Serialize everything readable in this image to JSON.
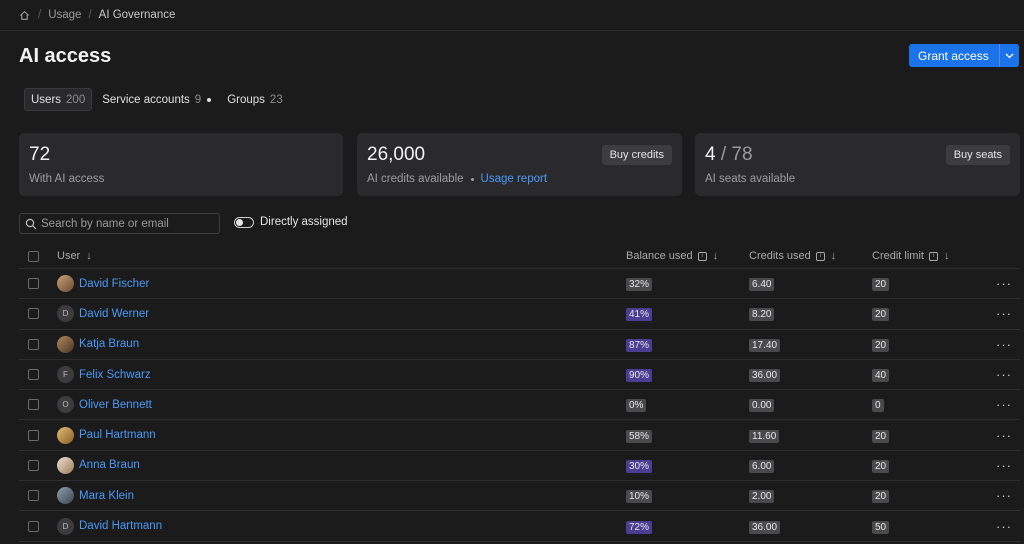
{
  "breadcrumb": {
    "items": [
      "Usage",
      "AI Governance"
    ]
  },
  "page": {
    "title": "AI access",
    "grant_label": "Grant access"
  },
  "tabs": [
    {
      "label": "Users",
      "count": "200"
    },
    {
      "label": "Service accounts",
      "count": "9"
    },
    {
      "label": "Groups",
      "count": "23"
    }
  ],
  "cards": {
    "access": {
      "value": "72",
      "label": "With AI access"
    },
    "credits": {
      "value": "26,000",
      "label": "AI credits available",
      "link": "Usage report",
      "button": "Buy credits"
    },
    "seats": {
      "used": "4",
      "separator": "/",
      "total": "78",
      "label": "AI seats available",
      "button": "Buy seats"
    }
  },
  "filters": {
    "search_placeholder": "Search by name or email",
    "toggle_label": "Directly assigned"
  },
  "table": {
    "headers": {
      "user": "User",
      "balance": "Balance used",
      "credits": "Credits used",
      "limit": "Credit limit"
    },
    "rows": [
      {
        "name": "David Fischer",
        "avatar": "photo",
        "balance": "32%",
        "credits": "6.40",
        "limit": "20"
      },
      {
        "name": "David Werner",
        "avatar": "D",
        "balance": "41%",
        "credits": "8.20",
        "limit": "20"
      },
      {
        "name": "Katja Braun",
        "avatar": "photo",
        "balance": "87%",
        "credits": "17.40",
        "limit": "20"
      },
      {
        "name": "Felix Schwarz",
        "avatar": "F",
        "balance": "90%",
        "credits": "36.00",
        "limit": "40"
      },
      {
        "name": "Oliver Bennett",
        "avatar": "O",
        "balance": "0%",
        "credits": "0.00",
        "limit": "0"
      },
      {
        "name": "Paul Hartmann",
        "avatar": "photo",
        "balance": "58%",
        "credits": "11.60",
        "limit": "20"
      },
      {
        "name": "Anna Braun",
        "avatar": "photo",
        "balance": "30%",
        "credits": "6.00",
        "limit": "20"
      },
      {
        "name": "Mara Klein",
        "avatar": "photo",
        "balance": "10%",
        "credits": "2.00",
        "limit": "20"
      },
      {
        "name": "David Hartmann",
        "avatar": "D",
        "balance": "72%",
        "credits": "36.00",
        "limit": "50"
      }
    ]
  },
  "colors": {
    "accent": "#1a73e8",
    "link": "#4a9af5",
    "purple_badge": "#4b3d91"
  }
}
